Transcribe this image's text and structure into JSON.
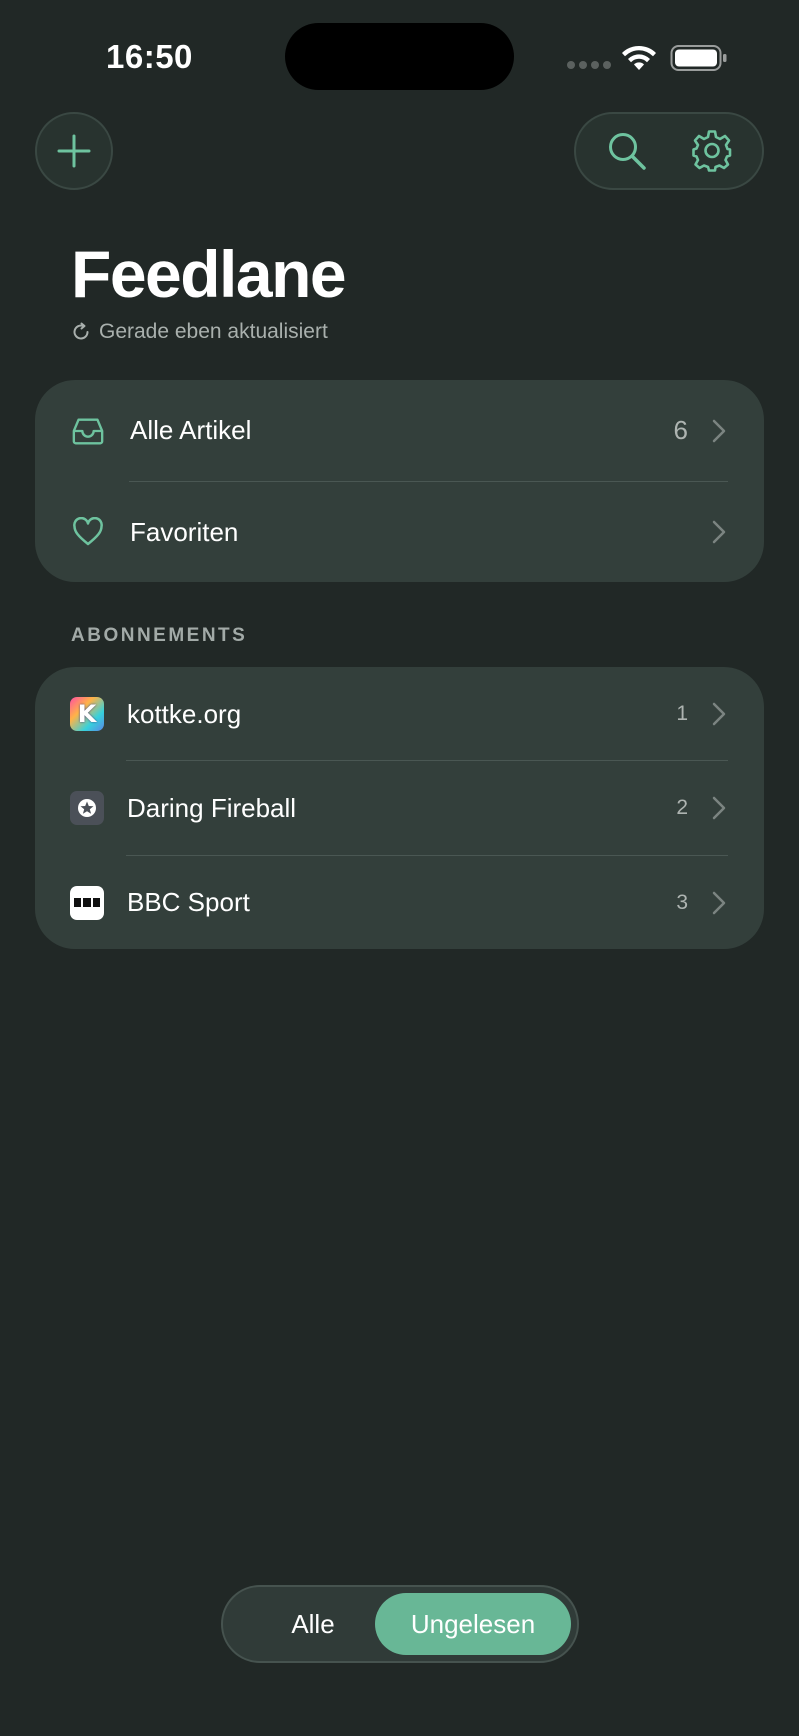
{
  "status_bar": {
    "time": "16:50"
  },
  "header": {
    "title": "Feedlane",
    "refresh_status": "Gerade eben aktualisiert"
  },
  "main_list": [
    {
      "label": "Alle Artikel",
      "count": "6",
      "icon": "inbox-icon"
    },
    {
      "label": "Favoriten",
      "count": "",
      "icon": "heart-icon"
    }
  ],
  "subscriptions": {
    "section_label": "ABONNEMENTS",
    "items": [
      {
        "label": "kottke.org",
        "count": "1",
        "favicon_letter": "K"
      },
      {
        "label": "Daring Fireball",
        "count": "2"
      },
      {
        "label": "BBC Sport",
        "count": "3"
      }
    ]
  },
  "segmented": {
    "option_all": "Alle",
    "option_unread": "Ungelesen",
    "selected": "Ungelesen"
  },
  "colors": {
    "background": "#212826",
    "card": "#333f3b",
    "accent": "#68b796"
  }
}
